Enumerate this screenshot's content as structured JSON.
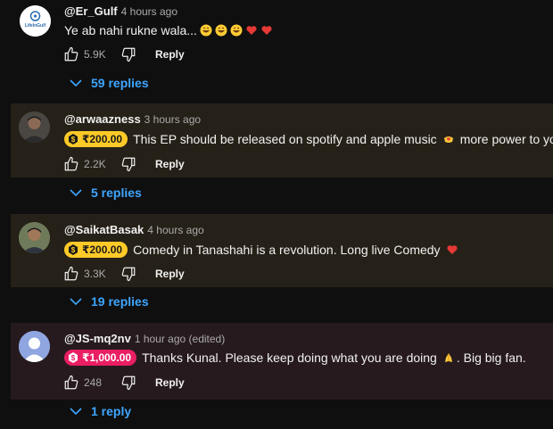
{
  "comments": [
    {
      "author": "@Er_Gulf",
      "time": "4 hours ago",
      "text": "Ye ab nahi rukne wala...",
      "likes": "5.9K",
      "reply_label": "Reply",
      "replies_label": "59 replies",
      "avatar_text": "LifeInGulf"
    },
    {
      "author": "@arwaazness",
      "time": "3 hours ago",
      "amount": "₹200.00",
      "text_before": "This EP should be released on spotify and apple music",
      "text_after": "more power to you",
      "likes": "2.2K",
      "reply_label": "Reply",
      "replies_label": "5 replies"
    },
    {
      "author": "@SaikatBasak",
      "time": "4 hours ago",
      "amount": "₹200.00",
      "text": "Comedy in Tanashahi is a revolution. Long live Comedy",
      "likes": "3.3K",
      "reply_label": "Reply",
      "replies_label": "19 replies"
    },
    {
      "author": "@JS-mq2nv",
      "time": "1 hour ago (edited)",
      "amount": "₹1,000.00",
      "text_before": "Thanks Kunal. Please keep doing what you are doing",
      "text_after": ". Big big fan.",
      "likes": "248",
      "reply_label": "Reply",
      "replies_label": "1 reply"
    }
  ],
  "colors": {
    "background": "#0f0f0f",
    "gold_super_bg": "#262118",
    "pink_super_bg": "#261a1f",
    "gold_chip": "#ffca28",
    "pink_chip": "#e91e63",
    "replies_link": "#3ea6ff",
    "heart": "#e53935"
  },
  "icons": [
    "thumb-up-icon",
    "thumb-down-icon",
    "chevron-down-icon",
    "super-thanks-icon",
    "heart-icon",
    "laugh-emoji-icon",
    "heart-hands-emoji-icon",
    "raised-fist-emoji-icon",
    "folded-hands-emoji-icon",
    "person-icon"
  ]
}
